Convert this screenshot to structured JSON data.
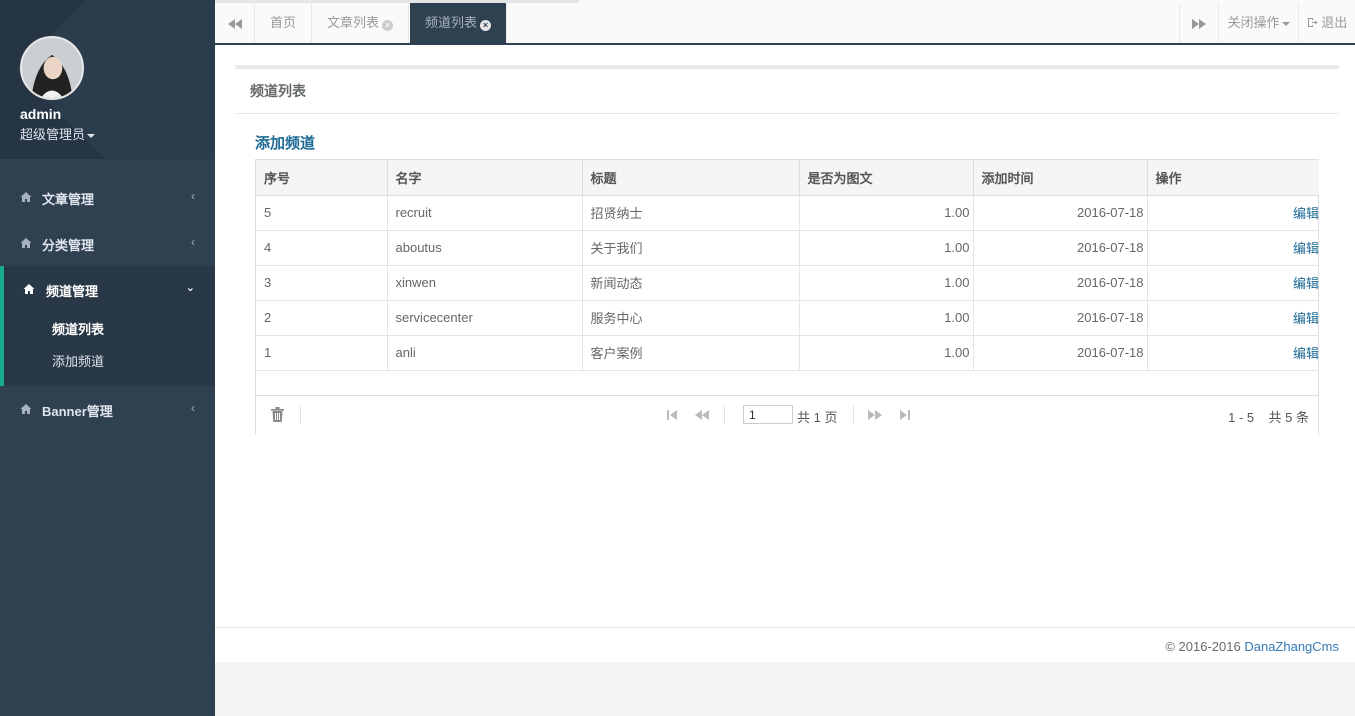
{
  "sidebar": {
    "user_name": "admin",
    "user_role": "超级管理员",
    "menus": [
      {
        "label": "文章管理",
        "arrow": "‹"
      },
      {
        "label": "分类管理",
        "arrow": "‹"
      },
      {
        "label": "频道管理",
        "arrow": "⌄"
      },
      {
        "label": "Banner管理",
        "arrow": "‹"
      }
    ],
    "submenu": [
      {
        "label": "频道列表"
      },
      {
        "label": "添加频道"
      }
    ]
  },
  "tabs": [
    {
      "label": "首页"
    },
    {
      "label": "文章列表"
    },
    {
      "label": "频道列表"
    }
  ],
  "toolbar": {
    "close_ops": "关闭操作",
    "logout": "退出"
  },
  "page": {
    "title": "频道列表",
    "add_link": "添加频道"
  },
  "table": {
    "headers": [
      "序号",
      "名字",
      "标题",
      "是否为图文",
      "添加时间",
      "操作"
    ],
    "rows": [
      [
        "5",
        "recruit",
        "招贤纳士",
        "1.00",
        "2016-07-18",
        "编辑"
      ],
      [
        "4",
        "aboutus",
        "关于我们",
        "1.00",
        "2016-07-18",
        "编辑"
      ],
      [
        "3",
        "xinwen",
        "新闻动态",
        "1.00",
        "2016-07-18",
        "编辑"
      ],
      [
        "2",
        "servicecenter",
        "服务中心",
        "1.00",
        "2016-07-18",
        "编辑"
      ],
      [
        "1",
        "anli",
        "客户案例",
        "1.00",
        "2016-07-18",
        "编辑"
      ]
    ]
  },
  "pager": {
    "current_page": "1",
    "total_pages": "共 1 页",
    "info": "1 - 5    共 5 条"
  },
  "footer": {
    "copyright": "© 2016-2016 ",
    "brand": "DanaZhangCms"
  },
  "colors": {
    "sidebar_bg": "#2f4050",
    "accent": "#19aa8d",
    "link": "#1d6a96"
  }
}
